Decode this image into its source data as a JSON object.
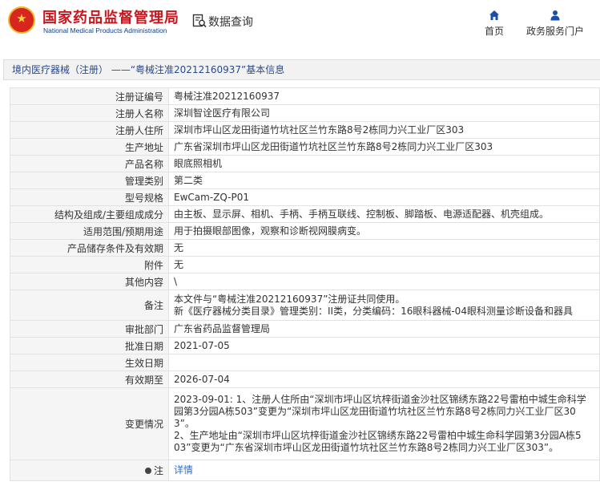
{
  "header": {
    "agency_cn": "国家药品监督管理局",
    "agency_en": "National Medical Products Administration",
    "query_label": "数据查询",
    "nav": [
      {
        "label": "首页",
        "icon": "home-icon"
      },
      {
        "label": "政务服务门户",
        "icon": "user-icon"
      }
    ]
  },
  "breadcrumb": "境内医疗器械（注册） ——“粤械注准20212160937”基本信息",
  "rows": [
    {
      "label": "注册证编号",
      "value": "粤械注准20212160937"
    },
    {
      "label": "注册人名称",
      "value": "深圳智诠医疗有限公司"
    },
    {
      "label": "注册人住所",
      "value": "深圳市坪山区龙田街道竹坑社区兰竹东路8号2栋同力兴工业厂区303"
    },
    {
      "label": "生产地址",
      "value": "广东省深圳市坪山区龙田街道竹坑社区兰竹东路8号2栋同力兴工业厂区303"
    },
    {
      "label": "产品名称",
      "value": "眼底照相机"
    },
    {
      "label": "管理类别",
      "value": "第二类"
    },
    {
      "label": "型号规格",
      "value": "EwCam-ZQ-P01"
    },
    {
      "label": "结构及组成/主要组成成分",
      "value": "由主板、显示屏、相机、手柄、手柄互联线、控制板、脚踏板、电源适配器、机壳组成。"
    },
    {
      "label": "适用范围/预期用途",
      "value": "用于拍摄眼部图像，观察和诊断视网膜病变。"
    },
    {
      "label": "产品储存条件及有效期",
      "value": "无"
    },
    {
      "label": "附件",
      "value": "无"
    },
    {
      "label": "其他内容",
      "value": "\\"
    },
    {
      "label": "备注",
      "value_lines": [
        "本文件与“粤械注准20212160937”注册证共同使用。",
        "新《医疗器械分类目录》管理类别：II类，分类编码：16眼科器械-04眼科测量诊断设备和器具"
      ]
    },
    {
      "label": "审批部门",
      "value": "广东省药品监督管理局"
    },
    {
      "label": "批准日期",
      "value": "2021-07-05"
    },
    {
      "label": "生效日期",
      "value": ""
    },
    {
      "label": "有效期至",
      "value": "2026-07-04"
    },
    {
      "label": "变更情况",
      "value_lines": [
        "2023-09-01: 1、注册人住所由“深圳市坪山区坑梓街道金沙社区锦绣东路22号雷柏中城生命科学",
        "园第3分园A栋503”变更为“深圳市坪山区龙田街道竹坑社区兰竹东路8号2栋同力兴工业厂区30",
        "3”。",
        "2、生产地址由“深圳市坪山区坑梓街道金沙社区锦绣东路22号雷柏中城生命科学园第3分园A栋5",
        "03”变更为“广东省深圳市坪山区龙田街道竹坑社区兰竹东路8号2栋同力兴工业厂区303”。"
      ]
    },
    {
      "label": "注",
      "value": "详情"
    }
  ]
}
